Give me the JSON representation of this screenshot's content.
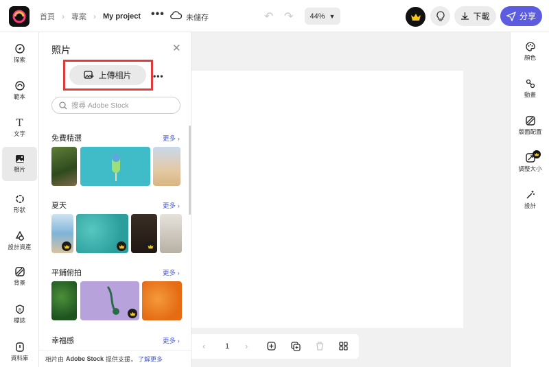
{
  "header": {
    "breadcrumb": [
      "首頁",
      "專案",
      "My project"
    ],
    "more_label": "•••",
    "save_status": "未儲存",
    "zoom": "44%",
    "download_label": "下載",
    "share_label": "分享",
    "colors": {
      "share": "#5c5ce0",
      "link": "#4a5cd9",
      "highlight": "#e03a3a"
    }
  },
  "left_rail": [
    {
      "label": "探索",
      "icon": "explore-icon"
    },
    {
      "label": "範本",
      "icon": "templates-icon"
    },
    {
      "label": "文字",
      "icon": "text-icon"
    },
    {
      "label": "相片",
      "icon": "photo-icon",
      "active": true
    },
    {
      "label": "形狀",
      "icon": "shapes-icon"
    },
    {
      "label": "設計資產",
      "icon": "design-assets-icon"
    },
    {
      "label": "背景",
      "icon": "background-icon"
    },
    {
      "label": "標誌",
      "icon": "brand-icon"
    },
    {
      "label": "資料庫",
      "icon": "library-icon"
    }
  ],
  "panel": {
    "title": "照片",
    "upload_label": "上傳相片",
    "search_placeholder": "搜尋 Adobe Stock",
    "sections": [
      {
        "title": "免費精選",
        "more": "更多"
      },
      {
        "title": "夏天",
        "more": "更多"
      },
      {
        "title": "平鋪俯拍",
        "more": "更多"
      },
      {
        "title": "幸福感",
        "more": "更多"
      }
    ],
    "footer": {
      "prefix": "相片由",
      "brand": "Adobe Stock",
      "suffix": "提供支援，",
      "link": "了解更多"
    }
  },
  "bottom_bar": {
    "page": "1"
  },
  "right_rail": [
    {
      "label": "顏色",
      "icon": "palette-icon"
    },
    {
      "label": "動畫",
      "icon": "animation-icon"
    },
    {
      "label": "版面配置",
      "icon": "layout-icon"
    },
    {
      "label": "調整大小",
      "icon": "resize-icon",
      "premium": true
    },
    {
      "label": "設計",
      "icon": "magic-wand-icon"
    }
  ]
}
